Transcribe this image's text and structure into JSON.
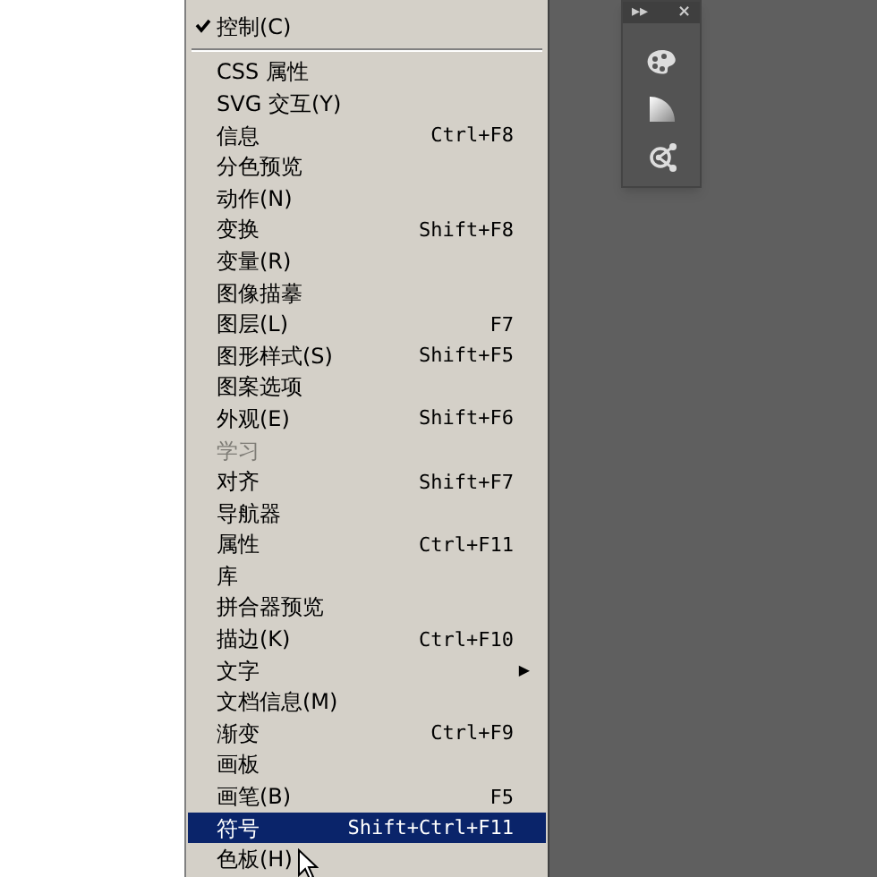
{
  "menu": {
    "items": [
      {
        "kind": "item",
        "label": "控制(C)",
        "checked": true,
        "disabled": false,
        "selected": false
      },
      {
        "kind": "separator"
      },
      {
        "kind": "item",
        "label": "CSS 属性",
        "checked": false,
        "disabled": false,
        "selected": false
      },
      {
        "kind": "item",
        "label": "SVG 交互(Y)",
        "checked": false,
        "disabled": false,
        "selected": false
      },
      {
        "kind": "item",
        "label": "信息",
        "shortcut": "Ctrl+F8",
        "checked": false,
        "disabled": false,
        "selected": false
      },
      {
        "kind": "item",
        "label": "分色预览",
        "checked": false,
        "disabled": false,
        "selected": false
      },
      {
        "kind": "item",
        "label": "动作(N)",
        "checked": false,
        "disabled": false,
        "selected": false
      },
      {
        "kind": "item",
        "label": "变换",
        "shortcut": "Shift+F8",
        "checked": false,
        "disabled": false,
        "selected": false
      },
      {
        "kind": "item",
        "label": "变量(R)",
        "checked": false,
        "disabled": false,
        "selected": false
      },
      {
        "kind": "item",
        "label": "图像描摹",
        "checked": false,
        "disabled": false,
        "selected": false
      },
      {
        "kind": "item",
        "label": "图层(L)",
        "shortcut": "F7",
        "checked": false,
        "disabled": false,
        "selected": false
      },
      {
        "kind": "item",
        "label": "图形样式(S)",
        "shortcut": "Shift+F5",
        "checked": false,
        "disabled": false,
        "selected": false
      },
      {
        "kind": "item",
        "label": "图案选项",
        "checked": false,
        "disabled": false,
        "selected": false
      },
      {
        "kind": "item",
        "label": "外观(E)",
        "shortcut": "Shift+F6",
        "checked": false,
        "disabled": false,
        "selected": false
      },
      {
        "kind": "item",
        "label": "学习",
        "checked": false,
        "disabled": true,
        "selected": false
      },
      {
        "kind": "item",
        "label": "对齐",
        "shortcut": "Shift+F7",
        "checked": false,
        "disabled": false,
        "selected": false
      },
      {
        "kind": "item",
        "label": "导航器",
        "checked": false,
        "disabled": false,
        "selected": false
      },
      {
        "kind": "item",
        "label": "属性",
        "shortcut": "Ctrl+F11",
        "checked": false,
        "disabled": false,
        "selected": false
      },
      {
        "kind": "item",
        "label": "库",
        "checked": false,
        "disabled": false,
        "selected": false
      },
      {
        "kind": "item",
        "label": "拼合器预览",
        "checked": false,
        "disabled": false,
        "selected": false
      },
      {
        "kind": "item",
        "label": "描边(K)",
        "shortcut": "Ctrl+F10",
        "checked": false,
        "disabled": false,
        "selected": false
      },
      {
        "kind": "submenu",
        "label": "文字",
        "submenu_arrow": "▶",
        "checked": false,
        "disabled": false,
        "selected": false
      },
      {
        "kind": "item",
        "label": "文档信息(M)",
        "checked": false,
        "disabled": false,
        "selected": false
      },
      {
        "kind": "item",
        "label": "渐变",
        "shortcut": "Ctrl+F9",
        "checked": false,
        "disabled": false,
        "selected": false
      },
      {
        "kind": "item",
        "label": "画板",
        "checked": false,
        "disabled": false,
        "selected": false
      },
      {
        "kind": "item",
        "label": "画笔(B)",
        "shortcut": "F5",
        "checked": false,
        "disabled": false,
        "selected": false
      },
      {
        "kind": "item",
        "label": "符号",
        "shortcut": "Shift+Ctrl+F11",
        "checked": false,
        "disabled": false,
        "selected": true
      },
      {
        "kind": "item",
        "label": "色板(H)",
        "checked": false,
        "disabled": false,
        "selected": false
      }
    ]
  },
  "panel": {
    "expand_glyph": "▸▸",
    "close_glyph": "×"
  }
}
